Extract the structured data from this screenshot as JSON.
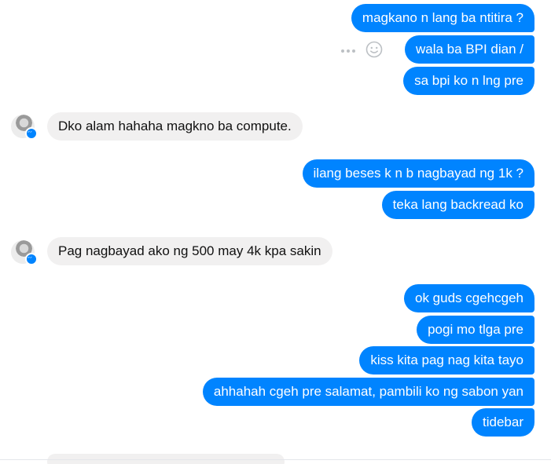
{
  "conversation": {
    "outgoing_group_1": [
      "magkano n lang ba ntitira ?",
      "wala ba BPI dian /",
      "sa bpi ko n lng pre"
    ],
    "incoming_1": "Dko alam hahaha magkno ba compute.",
    "outgoing_group_2": [
      "ilang beses k n b nagbayad ng 1k ?",
      "teka lang backread ko"
    ],
    "incoming_2": "Pag nagbayad ako ng 500 may 4k kpa sakin",
    "outgoing_group_3": [
      "ok guds cgehcgeh",
      "pogi mo tlga pre",
      "kiss kita pag nag kita tayo",
      "ahhahah cgeh pre salamat, pambili ko ng sabon yan",
      "tidebar"
    ]
  },
  "colors": {
    "outgoing_bubble": "#0084ff",
    "incoming_bubble": "#f1f0f0",
    "messenger_badge": "#0084ff"
  },
  "icons": {
    "message_actions": [
      "more-options-icon",
      "react-emoji-icon"
    ],
    "avatar_badge": "messenger-bolt-icon"
  }
}
